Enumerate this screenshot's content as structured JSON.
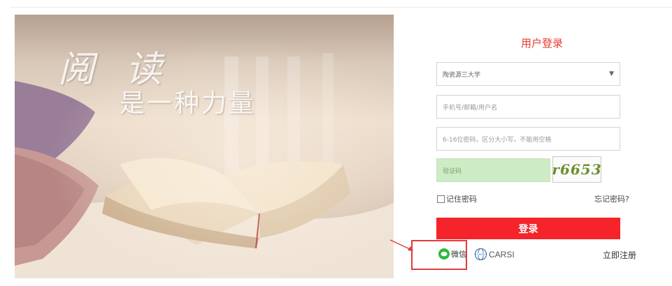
{
  "banner": {
    "calligraphy": "阅 读",
    "slogan": "是一种力量"
  },
  "login": {
    "title": "用户登录",
    "school_select": "陶瓷源三大学",
    "username_placeholder": "手机号/邮箱/用户名",
    "password_placeholder": "6-16位密码，区分大小写，不能用空格",
    "captcha_placeholder": "验证码",
    "captcha_text": "r6653",
    "remember_label": "记住密码",
    "forgot_label": "忘记密码?",
    "submit_label": "登录",
    "wechat_label": "微信",
    "carsi_label": "CARSI",
    "register_label": "立即注册"
  },
  "colors": {
    "accent_red": "#f5232a",
    "title_red": "#e8382f",
    "captcha_green": "#cdebc4",
    "wechat_green": "#2cb93e",
    "annotation_red": "#e23b3b"
  }
}
